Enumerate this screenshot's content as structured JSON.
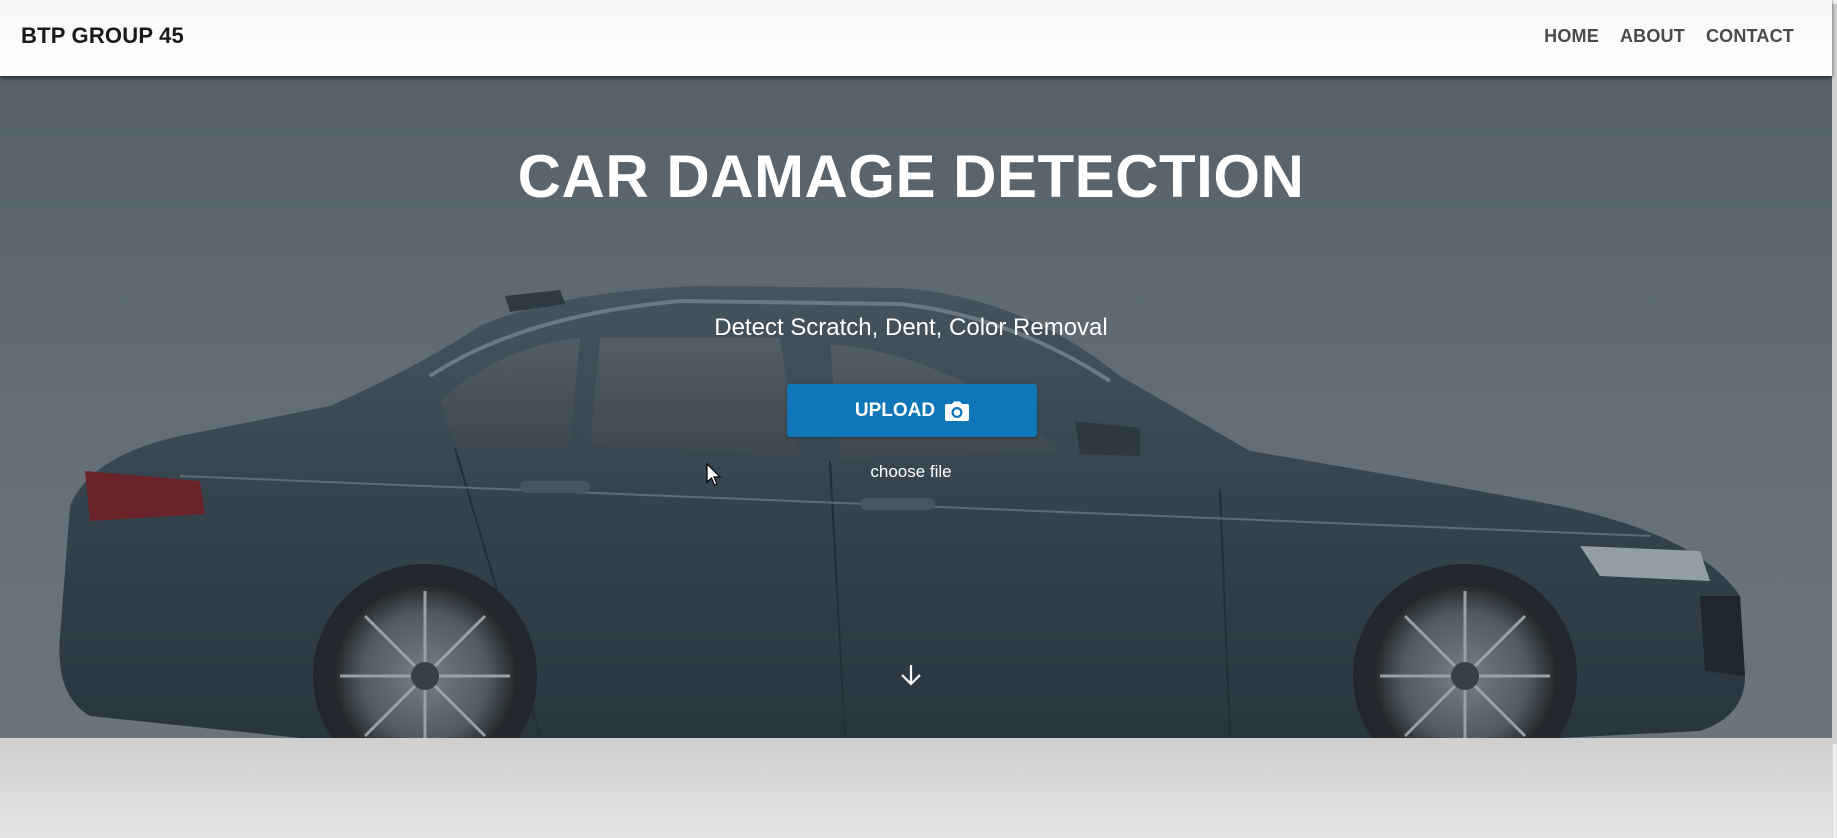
{
  "navbar": {
    "brand": "BTP GROUP 45",
    "links": [
      {
        "label": "HOME"
      },
      {
        "label": "ABOUT"
      },
      {
        "label": "CONTACT"
      }
    ]
  },
  "hero": {
    "title": "CAR DAMAGE DETECTION",
    "subtitle": "Detect Scratch, Dent, Color Removal",
    "upload_label": "UPLOAD",
    "upload_icon": "camera-icon",
    "choose_file_label": "choose file",
    "scroll_icon": "arrow-down-icon"
  },
  "colors": {
    "accent": "#0f76b8",
    "navbar_bg": "#ffffff",
    "hero_text": "#ffffff"
  }
}
